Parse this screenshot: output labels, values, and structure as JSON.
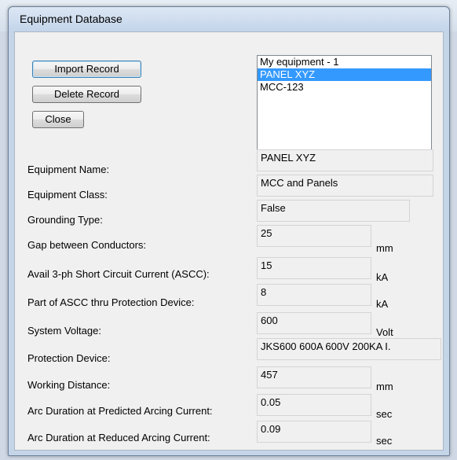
{
  "window": {
    "title": "Equipment Database"
  },
  "buttons": {
    "import_label": "Import Record",
    "delete_label": "Delete Record",
    "close_label": "Close"
  },
  "records": {
    "items": [
      "My equipment - 1",
      "PANEL XYZ",
      "MCC-123"
    ],
    "selected": "PANEL XYZ"
  },
  "form": {
    "equipment_name": {
      "label": "Equipment Name:",
      "value": "PANEL XYZ"
    },
    "equipment_class": {
      "label": "Equipment Class:",
      "value": "MCC and Panels"
    },
    "grounding_type": {
      "label": "Grounding Type:",
      "value": "False"
    },
    "gap": {
      "label": "Gap between Conductors:",
      "value": "25",
      "unit": "mm"
    },
    "ascc": {
      "label": "Avail 3-ph Short Circuit Current (ASCC):",
      "value": "15",
      "unit": "kA"
    },
    "ascc_part": {
      "label": "Part of ASCC thru Protection Device:",
      "value": "8",
      "unit": "kA"
    },
    "voltage": {
      "label": "System Voltage:",
      "value": "600",
      "unit": "Volt"
    },
    "protection": {
      "label": "Protection Device:",
      "value": "JKS600 600A 600V 200KA I."
    },
    "distance": {
      "label": "Working Distance:",
      "value": "457",
      "unit": "mm"
    },
    "arc_predicted": {
      "label": "Arc Duration at Predicted Arcing Current:",
      "value": "0.05",
      "unit": "sec"
    },
    "arc_reduced": {
      "label": "Arc Duration at Reduced Arcing Current:",
      "value": "0.09",
      "unit": "sec"
    }
  }
}
